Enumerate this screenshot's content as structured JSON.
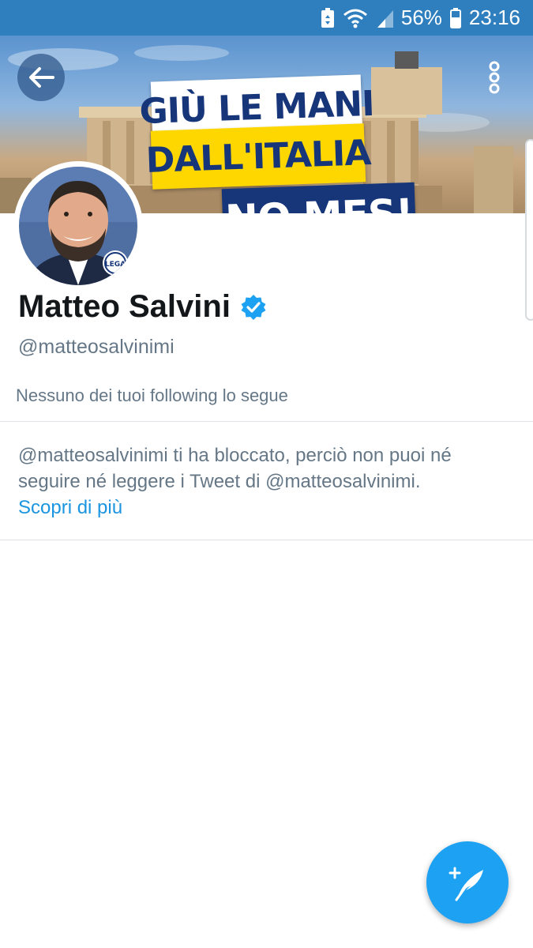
{
  "status_bar": {
    "battery_percent": "56%",
    "time": "23:16",
    "icons": [
      "battery-saver-icon",
      "wifi-icon",
      "signal-icon",
      "battery-icon"
    ]
  },
  "banner": {
    "line1": "GIÙ LE MANI",
    "line2": "DALL'ITALIA",
    "line3": "NO MES!",
    "colors": {
      "navy": "#17367a",
      "yellow": "#ffd700",
      "white": "#ffffff"
    }
  },
  "avatar": {
    "badge_text": "LEGA"
  },
  "profile": {
    "name": "Matteo Salvini",
    "verified": true,
    "handle": "@matteosalvinimi",
    "following_info": "Nessuno dei tuoi following lo segue"
  },
  "blocked": {
    "message": "@matteosalvinimi ti ha bloccato, perciò non puoi né seguire né leggere i Tweet di @matteosalvinimi.",
    "learn_more": "Scopri di più"
  },
  "colors": {
    "status_bar": "#2f7fbf",
    "accent": "#1da1f2",
    "link": "#1b95e0",
    "secondary_text": "#657786",
    "primary_text": "#14171a"
  },
  "icons": {
    "back": "back-arrow-icon",
    "more": "more-vertical-icon",
    "verified": "verified-badge-icon",
    "compose": "compose-tweet-icon"
  }
}
